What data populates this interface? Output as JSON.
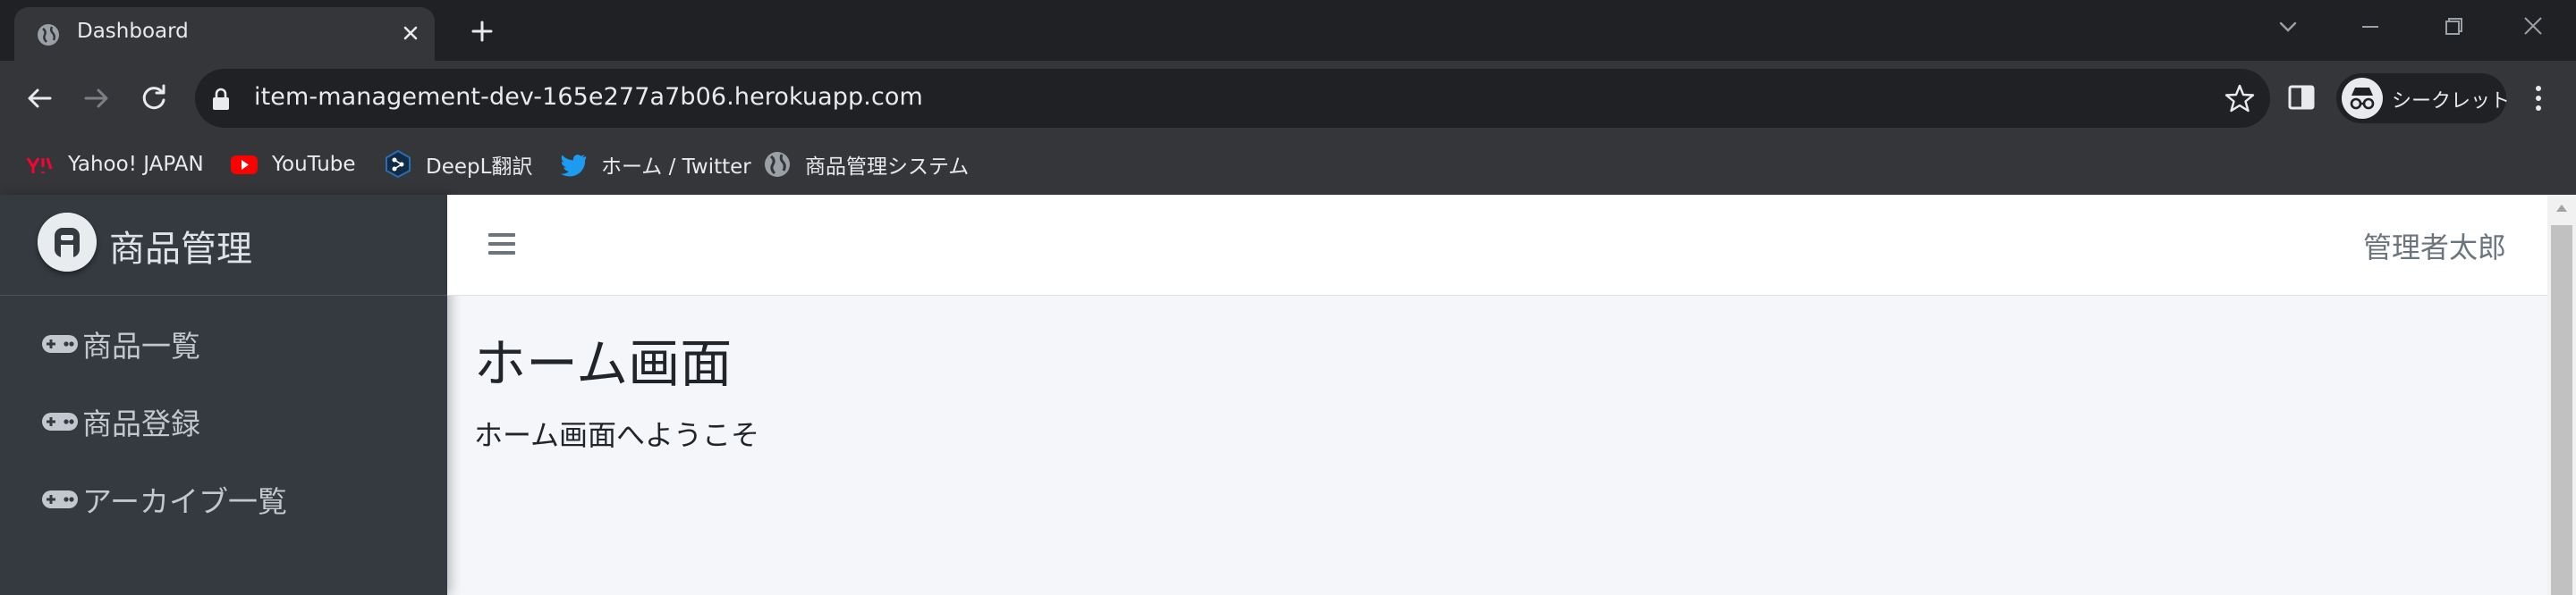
{
  "browser": {
    "tab_title": "Dashboard",
    "url": "item-management-dev-165e277a7b06.herokuapp.com",
    "incognito_label": "シークレット",
    "bookmarks": [
      {
        "label": "Yahoo! JAPAN",
        "icon": "yahoo-icon"
      },
      {
        "label": "YouTube",
        "icon": "youtube-icon"
      },
      {
        "label": "DeepL翻訳",
        "icon": "deepl-icon"
      },
      {
        "label": "ホーム / Twitter",
        "icon": "twitter-icon"
      },
      {
        "label": "商品管理システム",
        "icon": "globe-icon"
      }
    ]
  },
  "app": {
    "brand": "商品管理",
    "brand_logo_letter": "A",
    "sidebar": {
      "items": [
        {
          "label": "商品一覧",
          "icon": "gamepad-icon"
        },
        {
          "label": "商品登録",
          "icon": "gamepad-icon"
        },
        {
          "label": "アーカイブ一覧",
          "icon": "gamepad-icon"
        }
      ]
    },
    "header": {
      "user_name": "管理者太郎"
    },
    "content": {
      "title": "ホーム画面",
      "text": "ホーム画面へようこそ"
    }
  },
  "colors": {
    "sidebar_bg": "#343a40",
    "content_bg": "#f4f6f9",
    "chrome_dark": "#202124",
    "chrome_toolbar": "#35363a"
  }
}
